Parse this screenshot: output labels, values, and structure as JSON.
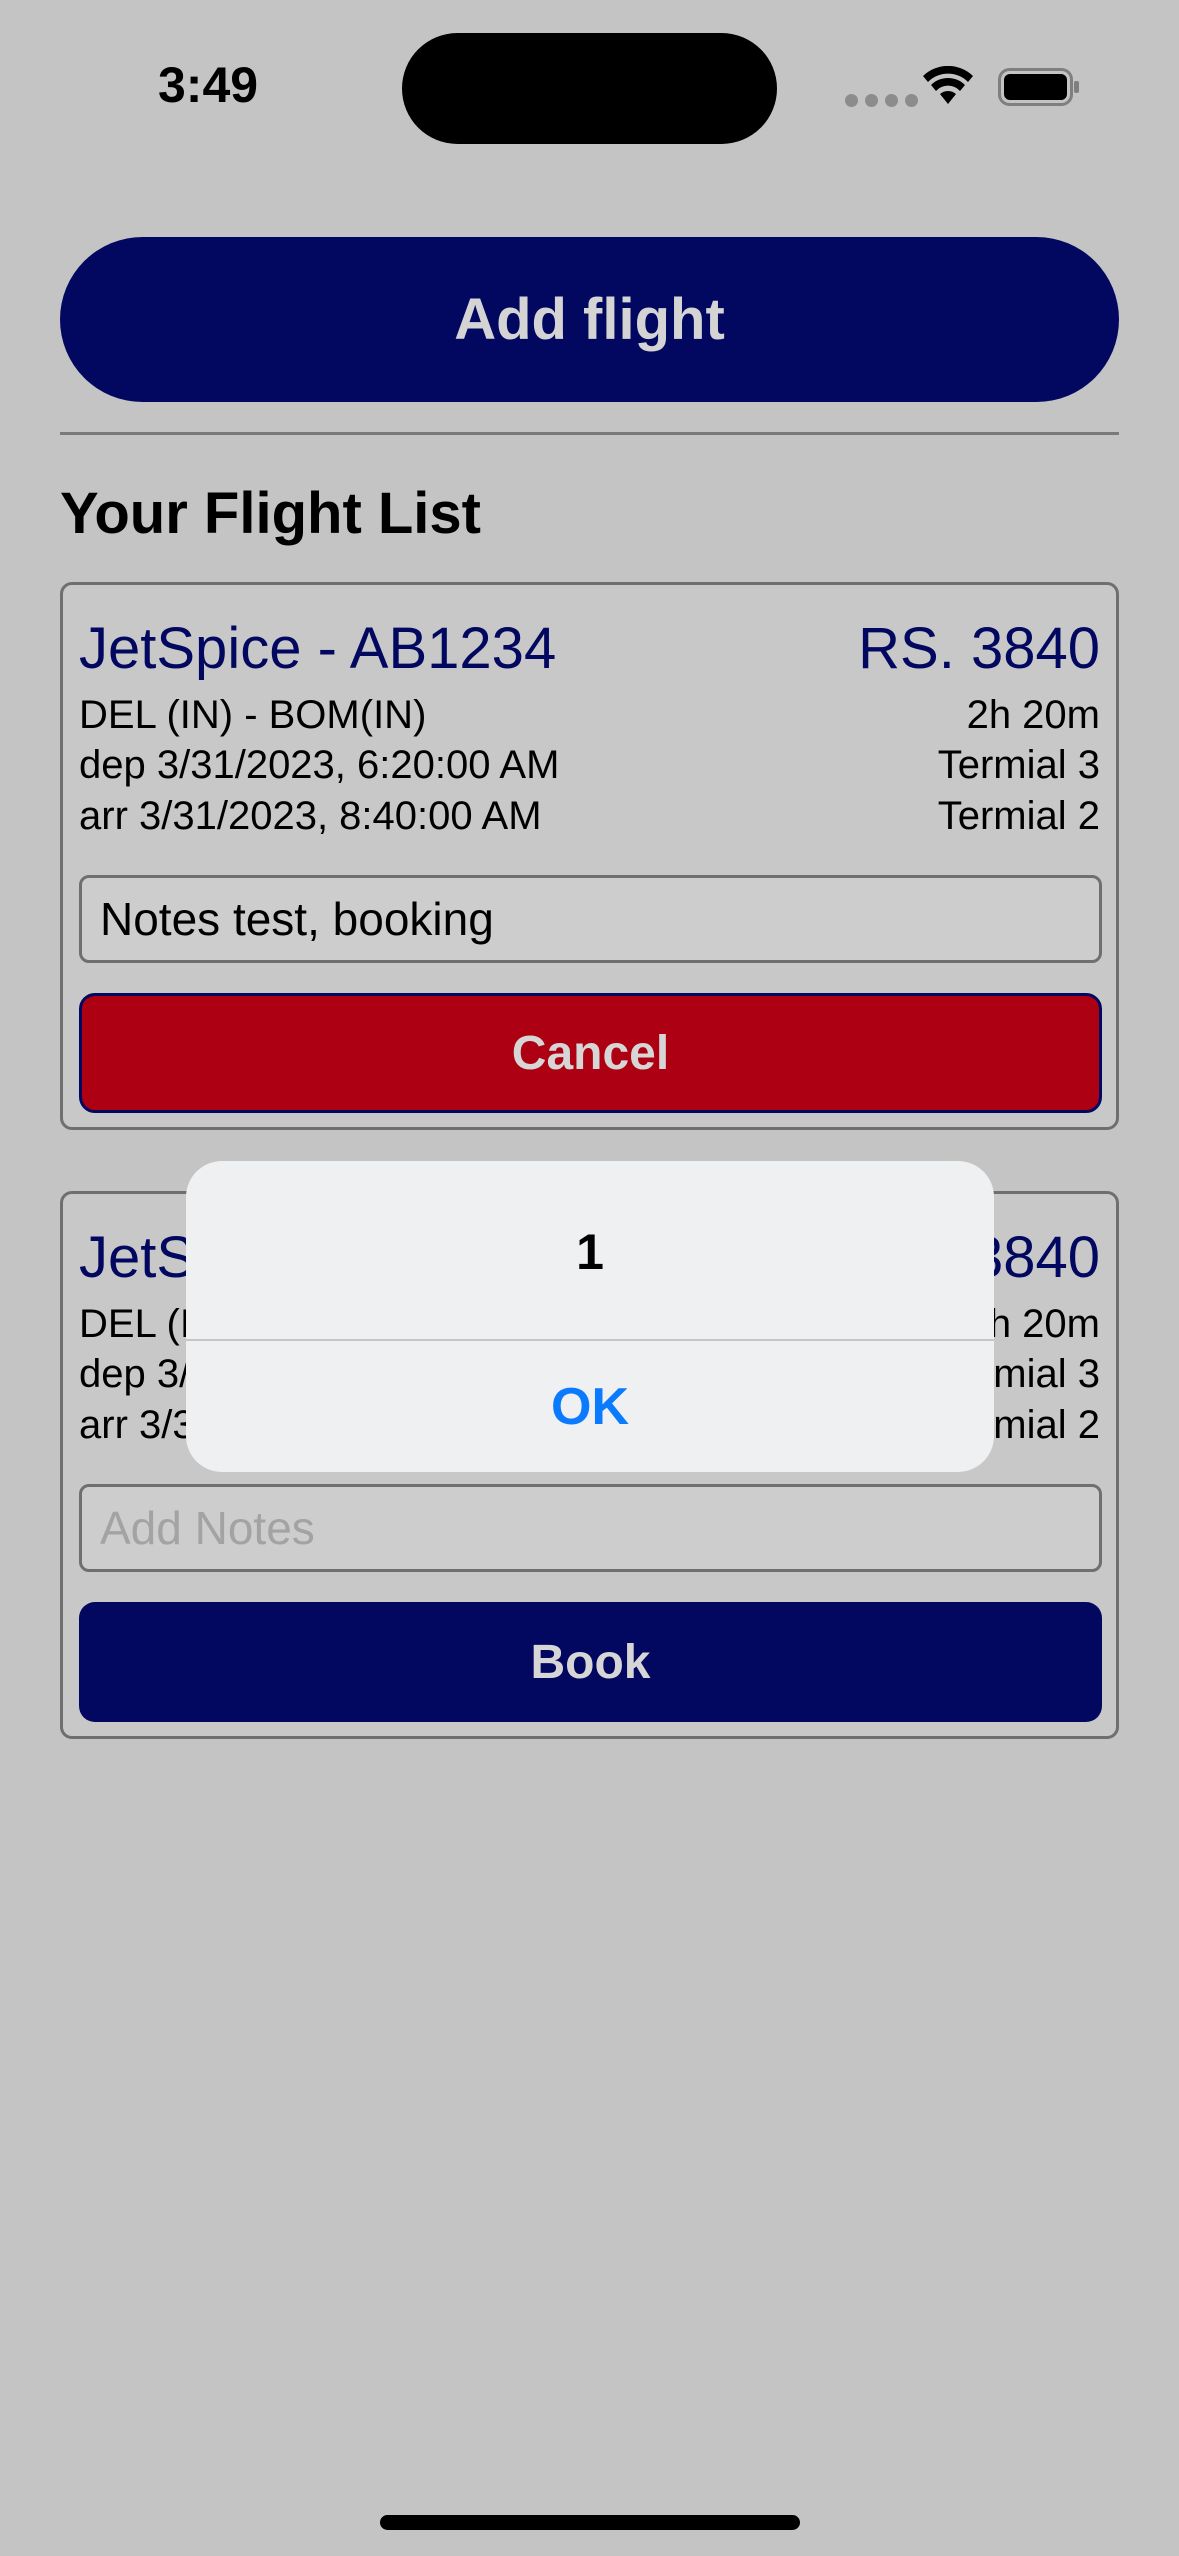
{
  "status_bar": {
    "time": "3:49"
  },
  "add_flight_label": "Add flight",
  "list_title": "Your Flight List",
  "flights": [
    {
      "airline": "JetSpice  - AB1234",
      "price": "RS. 3840",
      "route": "DEL (IN)  - BOM(IN)",
      "duration": "2h 20m",
      "departure": "dep 3/31/2023, 6:20:00 AM",
      "dep_terminal": "Termial 3",
      "arrival": "arr 3/31/2023, 8:40:00 AM",
      "arr_terminal": "Termial 2",
      "notes_value": "Notes test, booking",
      "notes_placeholder": "Add Notes",
      "action_label": "Cancel"
    },
    {
      "airline": "JetSpice  - AB1234",
      "price": "RS. 3840",
      "route": "DEL (IN)  - BOM(IN)",
      "duration": "2h 20m",
      "departure": "dep 3/31/2023, 6:20:00 AM",
      "dep_terminal": "Termial 3",
      "arrival": "arr 3/31/2023, 8:40:00 AM",
      "arr_terminal": "Termial 2",
      "notes_value": "",
      "notes_placeholder": "Add Notes",
      "action_label": "Book"
    }
  ],
  "alert": {
    "title": "1",
    "ok_label": "OK"
  },
  "colors": {
    "background": "#c4c4c4",
    "navy": "#020860",
    "cancel_red": "#ad0012",
    "alert_blue": "#0a7aff"
  },
  "icons": [
    "signal-dots-icon",
    "wifi-icon",
    "battery-icon"
  ]
}
